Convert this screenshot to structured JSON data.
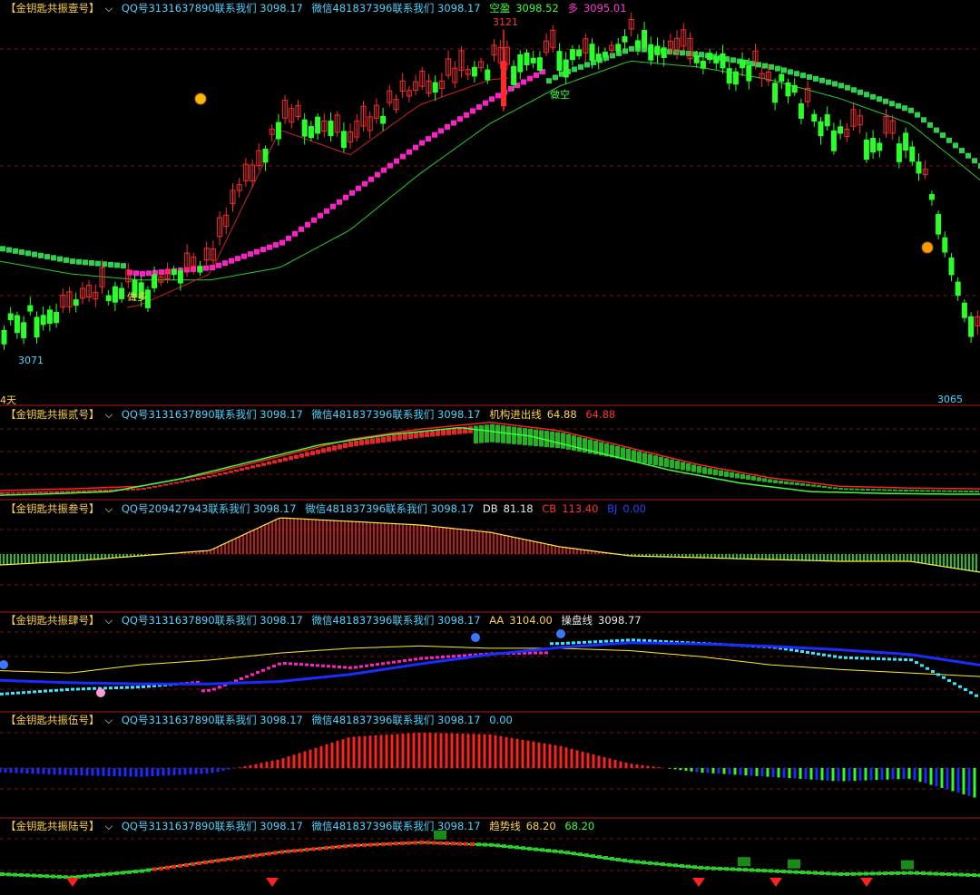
{
  "panels": [
    {
      "id": "p1",
      "title": "【金钥匙共振壹号】",
      "qq": "QQ号3131637890联系我们 3098.17",
      "wx": "微信481837396联系我们 3098.17",
      "extra": [
        {
          "text": "空盈",
          "color": "#3cff3c"
        },
        {
          "text": "3098.52",
          "color": "#3cff3c"
        },
        {
          "text": "多",
          "color": "#ff3cd6"
        },
        {
          "text": "3095.01",
          "color": "#ff3cd6"
        }
      ]
    },
    {
      "id": "p2",
      "title": "【金钥匙共振贰号】",
      "qq": "QQ号3131637890联系我们 3098.17",
      "wx": "微信481837396联系我们 3098.17",
      "extra": [
        {
          "text": "机构进出线",
          "color": "#ffd24a"
        },
        {
          "text": "64.88",
          "color": "#ffd24a"
        },
        {
          "text": "64.88",
          "color": "#ff3030"
        }
      ]
    },
    {
      "id": "p3",
      "title": "【金钥匙共振叁号】",
      "qq": "QQ号209427943联系我们 3098.17",
      "wx": "微信481837396联系我们 3098.17",
      "extra": [
        {
          "text": "DB",
          "color": "#e8e8e8"
        },
        {
          "text": "81.18",
          "color": "#e8e8e8"
        },
        {
          "text": "CB",
          "color": "#ff3030"
        },
        {
          "text": "113.40",
          "color": "#ff3030"
        },
        {
          "text": "BJ",
          "color": "#2a40ff"
        },
        {
          "text": "0.00",
          "color": "#2a40ff"
        }
      ]
    },
    {
      "id": "p4",
      "title": "【金钥匙共振肆号】",
      "qq": "QQ号3131637890联系我们 3098.17",
      "wx": "微信481837396联系我们 3098.17",
      "extra": [
        {
          "text": "AA",
          "color": "#ffd24a"
        },
        {
          "text": "3104.00",
          "color": "#ffd24a"
        },
        {
          "text": "操盘线",
          "color": "#e8e8e8"
        },
        {
          "text": "3098.77",
          "color": "#e8e8e8"
        }
      ]
    },
    {
      "id": "p5",
      "title": "【金钥匙共振伍号】",
      "qq": "QQ号3131637890联系我们 3098.17",
      "wx": "微信481837396联系我们 3098.17",
      "extra": [
        {
          "text": "0.00",
          "color": "#4fd4ff"
        }
      ]
    },
    {
      "id": "p6",
      "title": "【金钥匙共振陆号】",
      "qq": "QQ号3131637890联系我们 3098.17",
      "wx": "微信481837396联系我们 3098.17",
      "extra": [
        {
          "text": "趋势线",
          "color": "#ffd24a"
        },
        {
          "text": "68.20",
          "color": "#ffd24a"
        },
        {
          "text": "68.20",
          "color": "#3cff3c"
        }
      ]
    }
  ],
  "price_labels": {
    "high": "3121",
    "low_left": "3071",
    "low_right": "3065",
    "days": "4天",
    "signal": "做多",
    "signal2": "做空"
  },
  "colors": {
    "up": "#ff2a2a",
    "down": "#2bff2b",
    "magenta": "#ff20c8",
    "cyan": "#3ce6ff",
    "blue": "#1a2cff",
    "yellow": "#ffef20",
    "grid": "#7a1010"
  },
  "chart_data": [
    {
      "type": "line",
      "title": "【金钥匙共振壹号】",
      "x": [
        0,
        10,
        20,
        30,
        40,
        50,
        60,
        70,
        80,
        90,
        100,
        110,
        120,
        130,
        140
      ],
      "series": [
        {
          "name": "空盈",
          "values": [
            3086,
            3084,
            3083,
            3083,
            3085,
            3091,
            3100,
            3108,
            3114,
            3118,
            3117,
            3115,
            3112,
            3108,
            3099
          ]
        },
        {
          "name": "多",
          "values": [
            3083,
            3083,
            3082,
            3083,
            3087,
            3095,
            3103,
            3110,
            3116,
            3119,
            3116,
            3113,
            3109,
            3104,
            3097
          ]
        },
        {
          "name": "price",
          "values": [
            3074,
            3078,
            3080,
            3085,
            3108,
            3104,
            3112,
            3116,
            3117,
            3120,
            3117,
            3114,
            3105,
            3103,
            3070
          ]
        }
      ],
      "ylim": [
        3062,
        3124
      ]
    },
    {
      "type": "line",
      "title": "【金钥匙共振贰号】",
      "series": [
        {
          "name": "机构进出线",
          "values": [
            0,
            2,
            5,
            20,
            40,
            60,
            72,
            80,
            70,
            50,
            30,
            15,
            5,
            3,
            2
          ]
        }
      ],
      "ylim": [
        0,
        85
      ]
    },
    {
      "type": "bar",
      "title": "【金钥匙共振叁号】",
      "series": [
        {
          "name": "DB",
          "values": [
            -30,
            -20,
            -5,
            10,
            100,
            90,
            80,
            60,
            20,
            -5,
            -10,
            -15,
            -20,
            -20,
            -50
          ]
        }
      ],
      "ylim": [
        -70,
        110
      ]
    },
    {
      "type": "line",
      "title": "【金钥匙共振肆号】",
      "series": [
        {
          "name": "AA",
          "values": [
            3085,
            3083,
            3090,
            3094,
            3100,
            3104,
            3106,
            3104,
            3104,
            3102,
            3097,
            3090,
            3086,
            3083,
            3080
          ]
        }
      ],
      "ylim": [
        3060,
        3124
      ]
    },
    {
      "type": "bar",
      "title": "【金钥匙共振伍号】",
      "series": [
        {
          "name": "value",
          "values": [
            -5,
            -8,
            -10,
            -6,
            10,
            35,
            40,
            38,
            25,
            5,
            -5,
            -10,
            -15,
            -12,
            -35
          ]
        }
      ],
      "ylim": [
        -45,
        45
      ]
    },
    {
      "type": "line",
      "title": "【金钥匙共振陆号】",
      "series": [
        {
          "name": "趋势线",
          "values": [
            20,
            15,
            25,
            40,
            55,
            65,
            70,
            66,
            55,
            40,
            30,
            25,
            20,
            22,
            18
          ]
        }
      ],
      "ylim": [
        0,
        90
      ]
    }
  ]
}
